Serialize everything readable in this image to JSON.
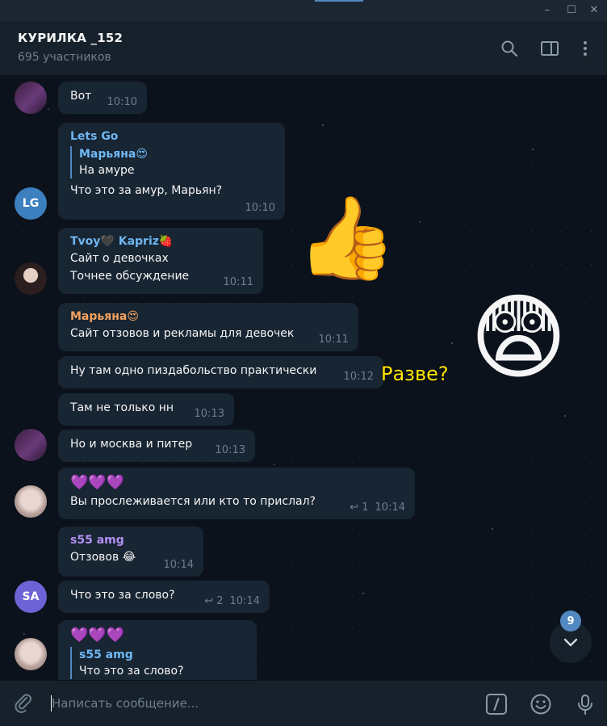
{
  "window": {
    "minimize": "–",
    "maximize": "☐",
    "close": "✕"
  },
  "header": {
    "title": "КУРИЛКА _152",
    "subtitle": "695 участников"
  },
  "colors": {
    "name_lets_go": "#6fb6f0",
    "name_tvoy": "#6fb6f0",
    "name_maryana": "#f3a25f",
    "name_s55": "#b190f3",
    "avatar_lg": "#3c80c0",
    "avatar_sa": "#6e63d6"
  },
  "messages": [
    {
      "id": "m1",
      "text": "Вот",
      "time": "10:10"
    },
    {
      "id": "m2",
      "sender": "Lets Go",
      "reply_name": "Марьяна😍",
      "reply_text": "На амуре",
      "text": "Что это за амур, Марьян?",
      "time": "10:10",
      "avatar_initials": "LG"
    },
    {
      "id": "m3",
      "sender": "Tvoy🖤 Kapriz🍓",
      "text": "Сайт о девочках",
      "text2": "Точнее обсуждение",
      "time": "10:11"
    },
    {
      "id": "m4",
      "sender": "Марьяна😍",
      "text": "Сайт отзовов и рекламы для девочек",
      "time": "10:11"
    },
    {
      "id": "m5",
      "text": "Ну там одно пиздабольство практически",
      "time": "10:12"
    },
    {
      "id": "m6",
      "text": "Там не только нн",
      "time": "10:13"
    },
    {
      "id": "m7",
      "text": "Но и москва и питер",
      "time": "10:13"
    },
    {
      "id": "m8",
      "text_top": "💜💜💜",
      "text": "Вы прослеживается или кто то прислал?",
      "replies": "1",
      "time": "10:14"
    },
    {
      "id": "m9",
      "sender": "s55 amg",
      "text": "Отзовов 😂",
      "time": "10:14"
    },
    {
      "id": "m10",
      "text": "Что это за слово?",
      "replies": "2",
      "time": "10:14",
      "avatar_initials": "SA"
    },
    {
      "id": "m11",
      "text_top": "💜💜💜",
      "reply_name": "s55 amg",
      "reply_text": "Что это за слово?"
    }
  ],
  "stickers": {
    "thumb": "👍",
    "scared": "😨",
    "razve_text": "Разве?"
  },
  "scroll": {
    "unread_count": "9"
  },
  "composer": {
    "placeholder": "Написать сообщение..."
  }
}
